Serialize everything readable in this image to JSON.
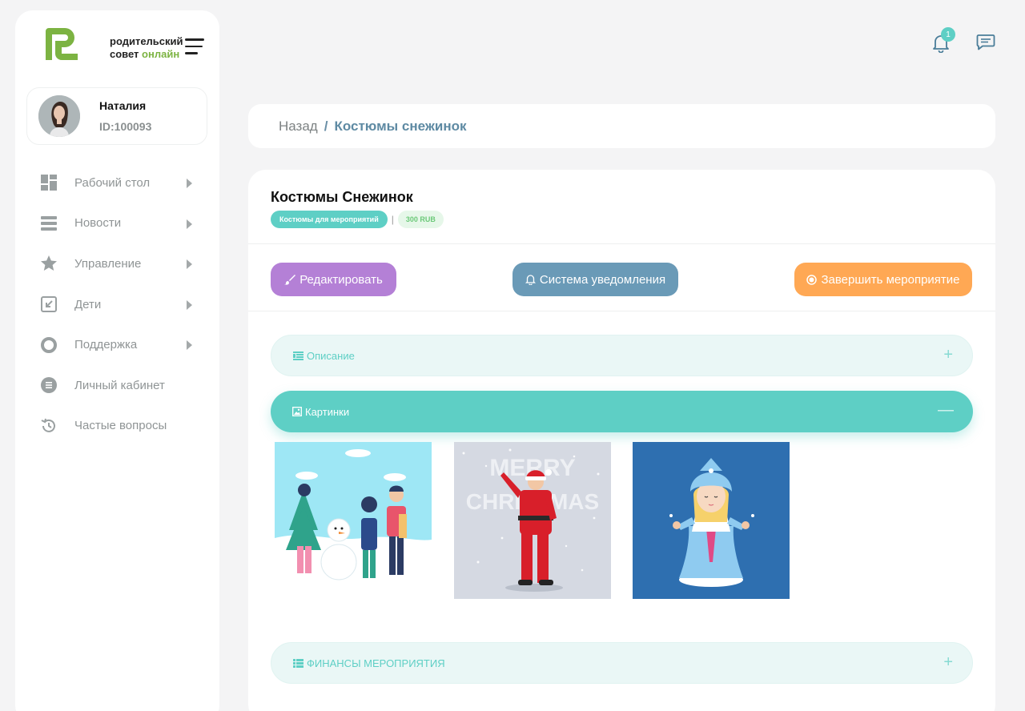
{
  "brand": {
    "line1": "родительский",
    "line2_a": "совет",
    "line2_b": "онлайн"
  },
  "profile": {
    "name": "Наталия",
    "id": "ID:100093"
  },
  "sidebar": {
    "items": [
      {
        "label": "Рабочий стол",
        "icon": "dashboard-icon",
        "arrow": true
      },
      {
        "label": "Новости",
        "icon": "news-icon",
        "arrow": true
      },
      {
        "label": "Управление",
        "icon": "star-icon",
        "arrow": true
      },
      {
        "label": "Дети",
        "icon": "children-icon",
        "arrow": true
      },
      {
        "label": "Поддержка",
        "icon": "lifebuoy-icon",
        "arrow": true
      },
      {
        "label": "Личный кабинет",
        "icon": "account-icon",
        "arrow": false
      },
      {
        "label": "Частые вопросы",
        "icon": "history-icon",
        "arrow": false
      }
    ]
  },
  "header": {
    "notification_count": "1"
  },
  "breadcrumb": {
    "back": "Назад",
    "separator": "/",
    "current": "Костюмы снежинок"
  },
  "event": {
    "title": "Костюмы Снежинок",
    "category": "Костюмы для мероприятий",
    "tag_separator": "|",
    "price": "300 RUB"
  },
  "actions": {
    "edit": "Редактировать",
    "notify": "Система уведомления",
    "finish": "Завершить мероприятие"
  },
  "sections": {
    "description": "Описание",
    "pictures": "Картинки",
    "finance": "ФИНАНСЫ МЕРОПРИЯТИЯ",
    "expand_symbol": "+",
    "collapse_symbol": "—"
  },
  "images": {
    "santa_text_1": "MERRY",
    "santa_text_2": "CHRISTMAS"
  },
  "colors": {
    "teal": "#5ecfc5",
    "purple": "#b480d6",
    "steel": "#6a9ab7",
    "orange": "#ffa854",
    "green": "#7cb342"
  }
}
